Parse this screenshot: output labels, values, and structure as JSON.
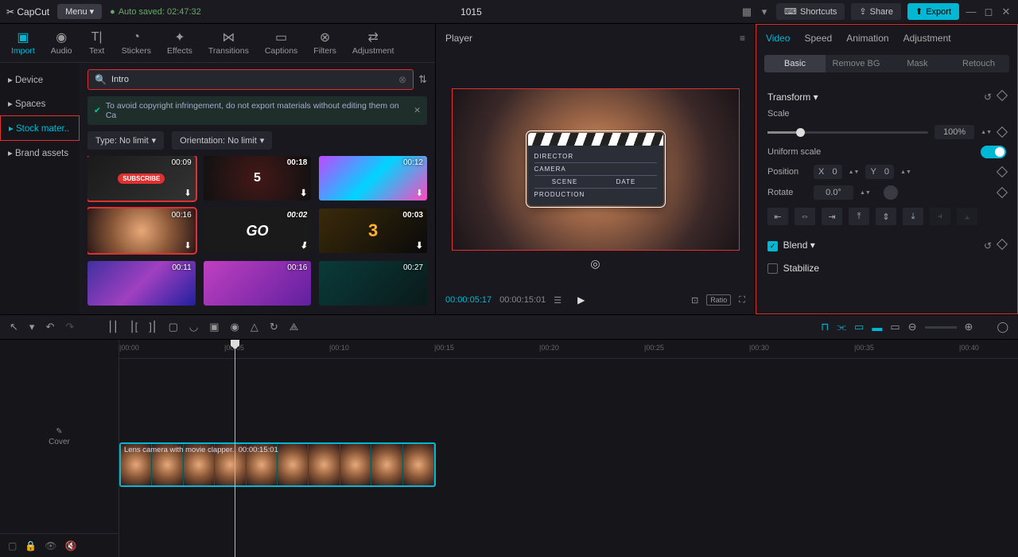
{
  "titlebar": {
    "logo": "✂ CapCut",
    "menu": "Menu ▾",
    "autosave": "Auto saved: 02:47:32",
    "project": "1015",
    "shortcuts": "Shortcuts",
    "share": "Share",
    "export": "Export"
  },
  "topTabs": [
    {
      "icon": "▣",
      "label": "Import",
      "active": true
    },
    {
      "icon": "◉",
      "label": "Audio"
    },
    {
      "icon": "T|",
      "label": "Text"
    },
    {
      "icon": "◔",
      "label": "Stickers"
    },
    {
      "icon": "✦",
      "label": "Effects"
    },
    {
      "icon": "⋈",
      "label": "Transitions"
    },
    {
      "icon": "▭",
      "label": "Captions"
    },
    {
      "icon": "⊗",
      "label": "Filters"
    },
    {
      "icon": "⇄",
      "label": "Adjustment"
    }
  ],
  "sideNav": [
    {
      "label": "Device",
      "active": false,
      "hl": false
    },
    {
      "label": "Spaces",
      "active": false,
      "hl": false
    },
    {
      "label": "Stock mater..",
      "active": true,
      "hl": true
    },
    {
      "label": "Brand assets",
      "active": false,
      "hl": false
    }
  ],
  "search": {
    "value": "Intro",
    "placeholder": "Search"
  },
  "warning": "To avoid copyright infringement, do not export materials without editing them on Ca",
  "filters": {
    "type": "Type: No limit",
    "orientation": "Orientation: No limit"
  },
  "thumbs": [
    {
      "cls": "t-sub",
      "dur": "00:09",
      "dl": true,
      "sel": true,
      "inner": "SUBSCRIBE"
    },
    {
      "cls": "t-5",
      "dur": "00:18",
      "dl": true,
      "inner": "5"
    },
    {
      "cls": "t-neon",
      "dur": "00:12",
      "dl": true
    },
    {
      "cls": "t-lens",
      "dur": "00:16",
      "dl": true,
      "sel": true
    },
    {
      "cls": "t-go",
      "dur": "00:02",
      "dl": true,
      "inner": "GO"
    },
    {
      "cls": "t-3",
      "dur": "00:03",
      "dl": true,
      "inner": "3"
    },
    {
      "cls": "t-space",
      "dur": "00:11"
    },
    {
      "cls": "t-grid",
      "dur": "00:16"
    },
    {
      "cls": "t-hud",
      "dur": "00:27"
    }
  ],
  "player": {
    "title": "Player",
    "clapper": {
      "director": "DIRECTOR",
      "camera": "CAMERA",
      "scene": "SCENE",
      "date": "DATE",
      "production": "PRODUCTION"
    },
    "tc_current": "00:00:05:17",
    "tc_total": "00:00:15:01",
    "ratio": "Ratio"
  },
  "inspector": {
    "tabs": [
      "Video",
      "Speed",
      "Animation",
      "Adjustment"
    ],
    "subtabs": [
      "Basic",
      "Remove BG",
      "Mask",
      "Retouch"
    ],
    "transform": "Transform",
    "scale_label": "Scale",
    "scale_value": "100%",
    "uniform": "Uniform scale",
    "position": "Position",
    "pos_x": "0",
    "pos_y": "0",
    "rotate": "Rotate",
    "rotate_val": "0.0°",
    "blend": "Blend",
    "stabilize": "Stabilize"
  },
  "timeline": {
    "marks": [
      "00:00",
      "00:05",
      "00:10",
      "00:15",
      "00:20",
      "00:25",
      "00:30",
      "00:35",
      "00:40"
    ],
    "clip_name": "Lens camera with movie clapper.",
    "clip_dur": "00:00:15:01",
    "cover": "Cover"
  }
}
